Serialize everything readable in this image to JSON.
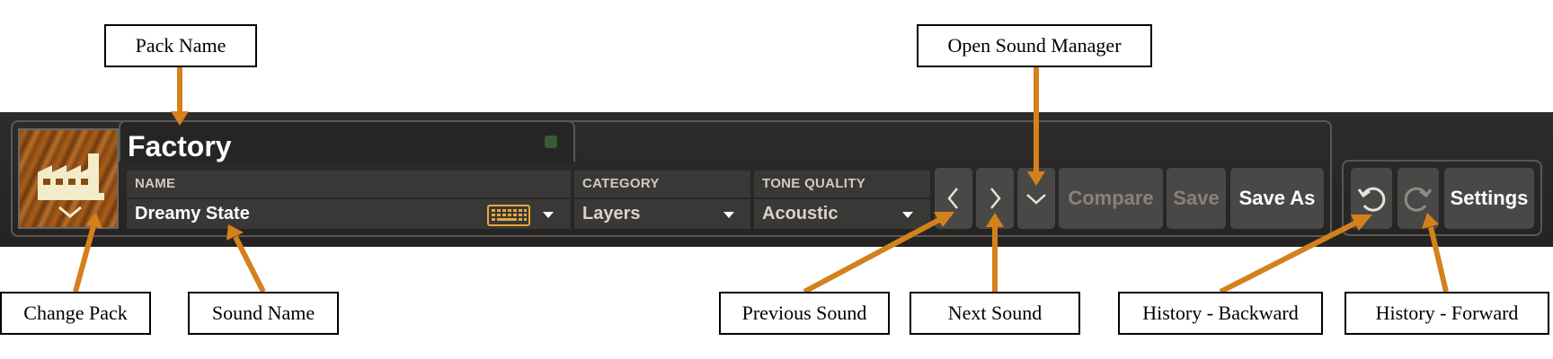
{
  "header": {
    "pack_name": "Factory"
  },
  "fields": {
    "name": {
      "label": "NAME",
      "value": "Dreamy State"
    },
    "category": {
      "label": "CATEGORY",
      "value": "Layers"
    },
    "tone_quality": {
      "label": "TONE QUALITY",
      "value": "Acoustic"
    }
  },
  "buttons": {
    "compare": "Compare",
    "save": "Save",
    "save_as": "Save As",
    "settings": "Settings"
  },
  "icons": {
    "pack": "factory-icon",
    "change_pack": "chevron-down-icon",
    "keyboard": "keyboard-icon",
    "previous": "chevron-left-icon",
    "next": "chevron-right-icon",
    "sound_manager": "chevron-down-icon",
    "undo": "undo-icon",
    "redo": "redo-icon"
  },
  "callouts": {
    "pack_name": "Pack Name",
    "open_sound_manager": "Open Sound Manager",
    "change_pack": "Change Pack",
    "sound_name": "Sound Name",
    "previous_sound": "Previous Sound",
    "next_sound": "Next Sound",
    "history_backward": "History - Backward",
    "history_forward": "History - Forward"
  },
  "colors": {
    "accent_orange": "#d4811c",
    "bar_background": "#2a2826",
    "button": "#4a4846",
    "disabled_text": "#86827d",
    "keyboard_icon": "#e8a63a",
    "pack_icon": "#f3eccb"
  }
}
